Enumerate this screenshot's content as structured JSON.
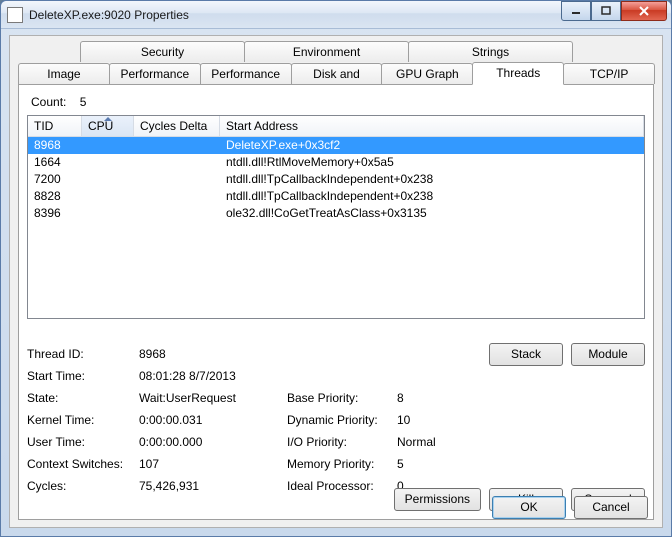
{
  "window": {
    "title": "DeleteXP.exe:9020 Properties"
  },
  "tabs": {
    "row1": [
      "Security",
      "Environment",
      "Strings"
    ],
    "row2": [
      "Image",
      "Performance",
      "Performance Graph",
      "Disk and Network",
      "GPU Graph",
      "Threads",
      "TCP/IP"
    ],
    "active": "Threads"
  },
  "count": {
    "label": "Count:",
    "value": "5"
  },
  "columns": {
    "tid": "TID",
    "cpu": "CPU",
    "cd": "Cycles Delta",
    "sa": "Start Address"
  },
  "threads": [
    {
      "tid": "8968",
      "cpu": "",
      "cd": "",
      "sa": "DeleteXP.exe+0x3cf2",
      "selected": true
    },
    {
      "tid": "1664",
      "cpu": "",
      "cd": "",
      "sa": "ntdll.dll!RtlMoveMemory+0x5a5"
    },
    {
      "tid": "7200",
      "cpu": "",
      "cd": "",
      "sa": "ntdll.dll!TpCallbackIndependent+0x238"
    },
    {
      "tid": "8828",
      "cpu": "",
      "cd": "",
      "sa": "ntdll.dll!TpCallbackIndependent+0x238"
    },
    {
      "tid": "8396",
      "cpu": "",
      "cd": "",
      "sa": "ole32.dll!CoGetTreatAsClass+0x3135"
    }
  ],
  "detail": {
    "thread_id_label": "Thread ID:",
    "thread_id": "8968",
    "start_time_label": "Start Time:",
    "start_time": "08:01:28   8/7/2013",
    "state_label": "State:",
    "state": "Wait:UserRequest",
    "kernel_time_label": "Kernel Time:",
    "kernel_time": "0:00:00.031",
    "user_time_label": "User Time:",
    "user_time": "0:00:00.000",
    "ctx_sw_label": "Context Switches:",
    "ctx_sw": "107",
    "cycles_label": "Cycles:",
    "cycles": "75,426,931",
    "base_prio_label": "Base Priority:",
    "base_prio": "8",
    "dyn_prio_label": "Dynamic Priority:",
    "dyn_prio": "10",
    "io_prio_label": "I/O Priority:",
    "io_prio": "Normal",
    "mem_prio_label": "Memory Priority:",
    "mem_prio": "5",
    "ideal_proc_label": "Ideal Processor:",
    "ideal_proc": "0"
  },
  "buttons": {
    "stack": "Stack",
    "module": "Module",
    "permissions": "Permissions",
    "kill": "Kill",
    "suspend": "Suspend",
    "ok": "OK",
    "cancel": "Cancel"
  }
}
